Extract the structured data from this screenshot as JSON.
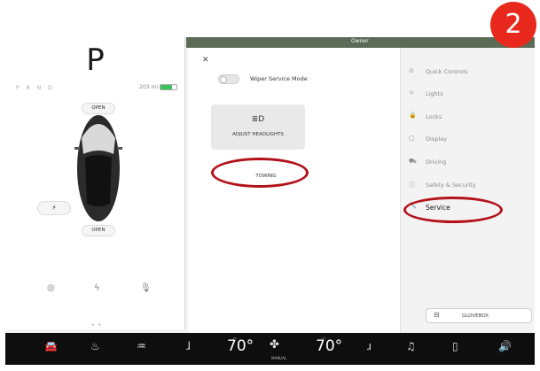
{
  "car": {
    "gear": "P",
    "gear_row": "P R N D",
    "range": "203 mi",
    "battery_fraction": 0.7,
    "open_frunk": "OPEN",
    "open_trunk": "OPEN",
    "charge_glyph": "⚡",
    "bottom_icons": [
      "◎",
      "ϟ",
      "🎙"
    ],
    "page_dots": "• •"
  },
  "map": {
    "owner": "Owner"
  },
  "popup": {
    "close_glyph": "✕",
    "wiper_label": "Wiper Service Mode",
    "headlights_icon": "≣D",
    "headlights_label": "ADJUST HEADLIGHTS",
    "towing_label": "TOWING"
  },
  "settings_nav": {
    "items": [
      {
        "icon": "⊙",
        "label": "Quick Controls"
      },
      {
        "icon": "☼",
        "label": "Lights"
      },
      {
        "icon": "🔒",
        "label": "Locks"
      },
      {
        "icon": "▢",
        "label": "Display"
      },
      {
        "icon": "⛟",
        "label": "Driving"
      },
      {
        "icon": "ⓘ",
        "label": "Safety & Security"
      },
      {
        "icon": "🔧",
        "label": "Service"
      }
    ],
    "glovebox_icon": "⊟",
    "glovebox_label": "GLOVEBOX"
  },
  "bottom_bar": {
    "car_icon": "🚘",
    "rear_defrost_icon": "♨",
    "front_defrost_icon": "♒",
    "seat_left_icon": "ɺ",
    "temp_left": "70°",
    "fan_icon": "✤",
    "fan_label": "MANUAL",
    "temp_right": "70°",
    "seat_right_icon": "ɹ",
    "music_icon": "♫",
    "phone_icon": "▯",
    "volume_icon": "🔊",
    "chevron_up": "︿"
  },
  "badge": {
    "number": "2"
  },
  "colors": {
    "accent_red": "#e8281c",
    "annotation": "#b3121a",
    "battery_green": "#3ec15d"
  }
}
